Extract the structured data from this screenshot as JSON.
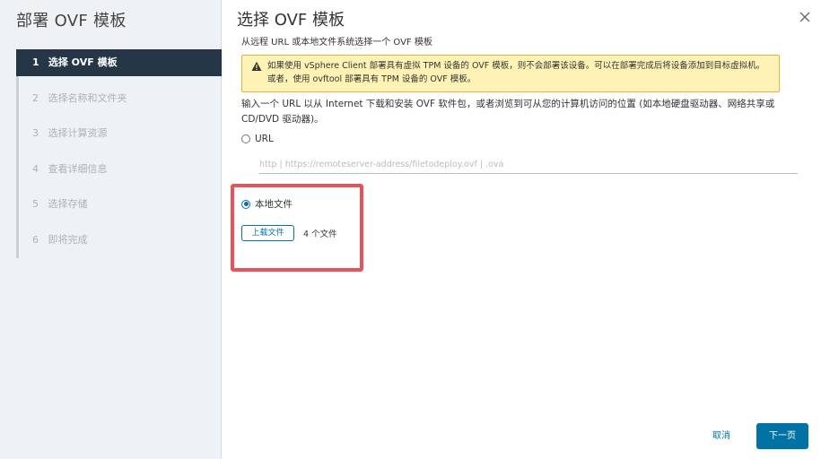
{
  "sidebar": {
    "title": "部署 OVF 模板",
    "steps": [
      {
        "num": "1",
        "label": "选择 OVF 模板",
        "active": true
      },
      {
        "num": "2",
        "label": "选择名称和文件夹",
        "active": false
      },
      {
        "num": "3",
        "label": "选择计算资源",
        "active": false
      },
      {
        "num": "4",
        "label": "查看详细信息",
        "active": false
      },
      {
        "num": "5",
        "label": "选择存储",
        "active": false
      },
      {
        "num": "6",
        "label": "即将完成",
        "active": false
      }
    ]
  },
  "main": {
    "title": "选择 OVF 模板",
    "close_icon": "close-icon",
    "subtitle": "从远程 URL 或本地文件系统选择一个 OVF 模板",
    "alert": {
      "icon": "warning-icon",
      "text": "如果使用 vSphere Client 部署具有虚拟 TPM 设备的 OVF 模板，则不会部署该设备。可以在部署完成后将设备添加到目标虚拟机。或者，使用 ovftool 部署具有 TPM 设备的 OVF 模板。"
    },
    "description": "输入一个 URL 以从 Internet 下载和安装 OVF 软件包，或者浏览到可从您的计算机访问的位置 (如本地硬盘驱动器、网络共享或 CD/DVD 驱动器)。",
    "url_option": {
      "label": "URL",
      "checked": false,
      "placeholder": "http | https://remoteserver-address/filetodeploy.ovf | .ova",
      "value": ""
    },
    "local_option": {
      "label": "本地文件",
      "checked": true
    },
    "upload_label": "上载文件",
    "file_count": "4 个文件"
  },
  "footer": {
    "cancel_label": "取消",
    "next_label": "下一页"
  },
  "colors": {
    "accent": "#0072a3",
    "sidebar_active_bg": "#253746",
    "alert_bg": "#fef3b5",
    "highlight": "#e8535a"
  }
}
